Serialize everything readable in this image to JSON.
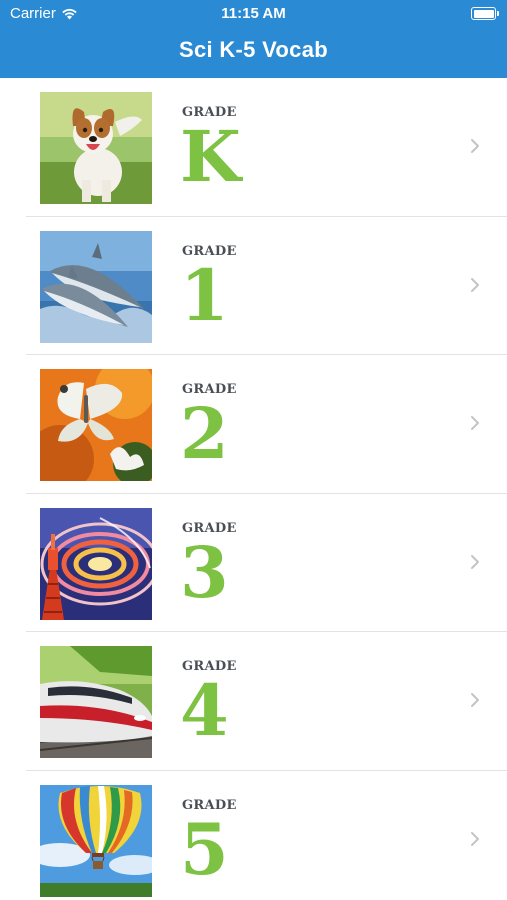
{
  "status_bar": {
    "carrier": "Carrier",
    "time": "11:15 AM",
    "wifi_icon": "wifi-icon",
    "battery_icon": "battery-icon"
  },
  "header": {
    "title": "Sci K-5 Vocab"
  },
  "grades": [
    {
      "label": "GRADE",
      "value": "K",
      "image": "dog-running"
    },
    {
      "label": "GRADE",
      "value": "1",
      "image": "dolphins-jumping"
    },
    {
      "label": "GRADE",
      "value": "2",
      "image": "butterfly-on-flower"
    },
    {
      "label": "GRADE",
      "value": "3",
      "image": "light-trails-tower"
    },
    {
      "label": "GRADE",
      "value": "4",
      "image": "high-speed-train"
    },
    {
      "label": "GRADE",
      "value": "5",
      "image": "hot-air-balloon"
    }
  ],
  "colors": {
    "header": "#2a8ad4",
    "grade_number": "#7dc242",
    "grade_label": "#4a4f55",
    "chevron": "#c4c4c8"
  }
}
